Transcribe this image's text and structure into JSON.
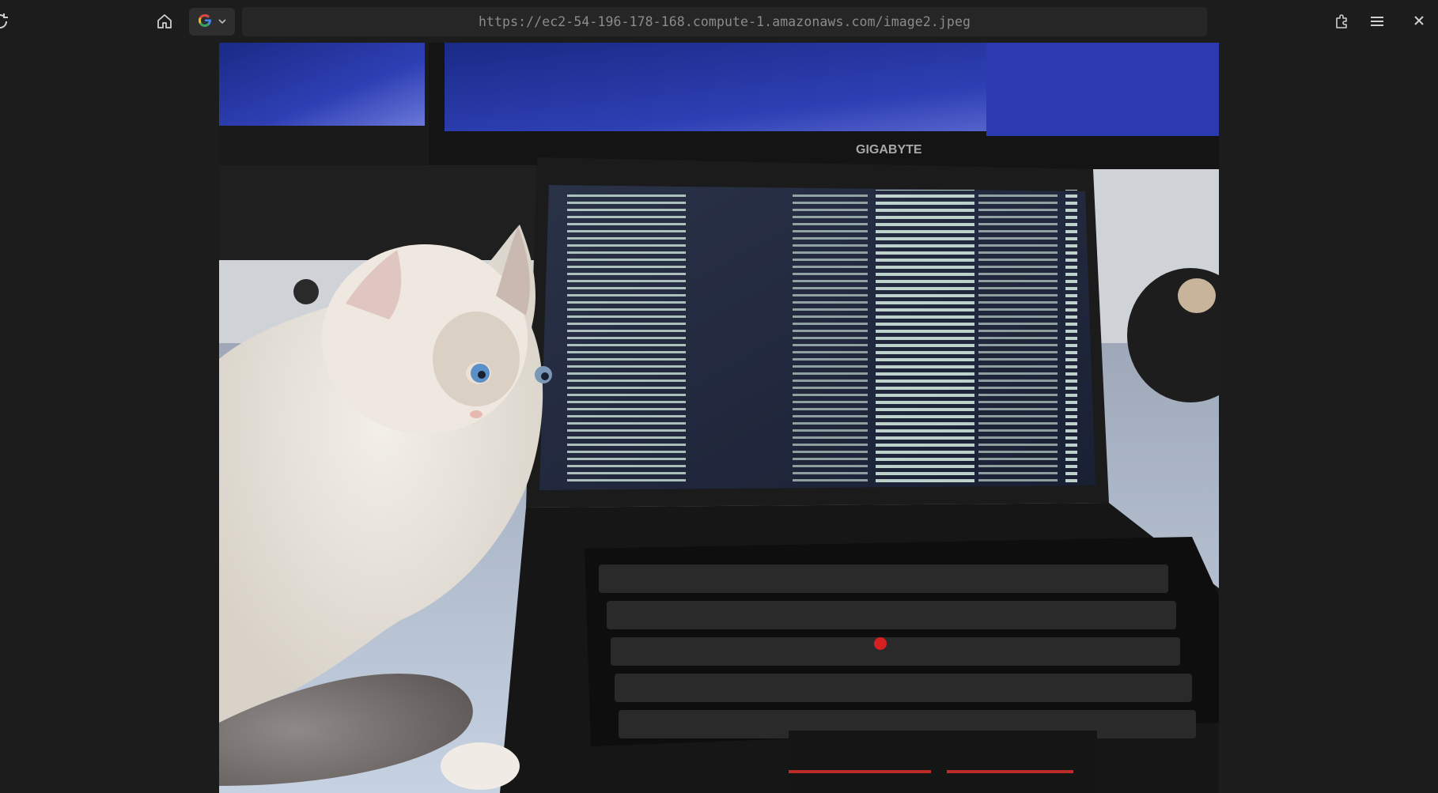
{
  "toolbar": {
    "url": "https://ec2-54-196-178-168.compute-1.amazonaws.com/image2.jpeg",
    "icons": {
      "reload": "reload-icon",
      "home": "home-icon",
      "search_engine": "google-icon",
      "dropdown": "chevron-down-icon",
      "extensions": "extensions-icon",
      "menu": "hamburger-menu-icon",
      "close": "close-icon"
    }
  },
  "image": {
    "subject": "white kitten beside laptop showing terminal",
    "laptop_brand": "GIGABYTE"
  },
  "colors": {
    "background": "#1c1c1c",
    "urlbar": "#262626",
    "url_text": "#8b8b8b",
    "terminal_text": "#d8f0e4"
  }
}
